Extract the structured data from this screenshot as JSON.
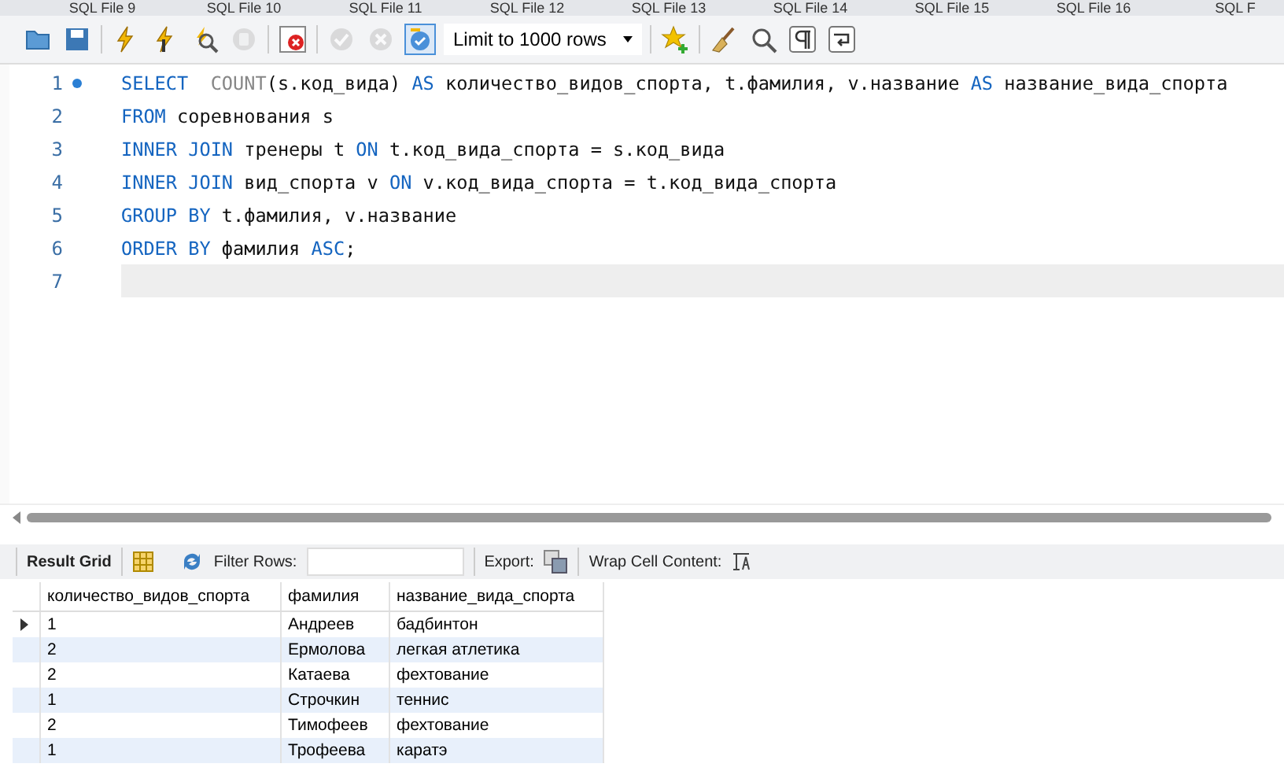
{
  "file_tabs": [
    {
      "label": "SQL File 9"
    },
    {
      "label": "SQL File 10"
    },
    {
      "label": "SQL File 11"
    },
    {
      "label": "SQL File 12"
    },
    {
      "label": "SQL File 13"
    },
    {
      "label": "SQL File 14"
    },
    {
      "label": "SQL File 15"
    },
    {
      "label": "SQL File 16"
    },
    {
      "label": "SQL F"
    }
  ],
  "toolbar": {
    "buttons": [
      {
        "kind": "folder",
        "disabled": false
      },
      {
        "kind": "save",
        "disabled": false
      },
      {
        "kind": "sep"
      },
      {
        "kind": "bolt",
        "disabled": false
      },
      {
        "kind": "bolt-cursor",
        "disabled": false
      },
      {
        "kind": "explain",
        "disabled": false
      },
      {
        "kind": "stop",
        "disabled": true
      },
      {
        "kind": "sep"
      },
      {
        "kind": "stop-on-error",
        "disabled": false
      },
      {
        "kind": "sep"
      },
      {
        "kind": "commit",
        "disabled": true
      },
      {
        "kind": "rollback",
        "disabled": true
      },
      {
        "kind": "autocommit",
        "disabled": false,
        "selected": true
      },
      {
        "kind": "limit",
        "value": "Limit to 1000 rows"
      },
      {
        "kind": "sep"
      },
      {
        "kind": "star",
        "disabled": false
      },
      {
        "kind": "sep"
      },
      {
        "kind": "broom",
        "disabled": false
      },
      {
        "kind": "find",
        "disabled": false
      },
      {
        "kind": "pilcrow",
        "disabled": false
      },
      {
        "kind": "wrap",
        "disabled": false
      }
    ]
  },
  "editor": {
    "lines": [
      {
        "number": "1",
        "marked": true,
        "current": false,
        "tokens": [
          {
            "kind": "keyword",
            "text": "SELECT  "
          },
          {
            "kind": "function",
            "text": "COUNT"
          },
          {
            "kind": "text",
            "text": "(s.код_вида) "
          },
          {
            "kind": "keyword",
            "text": "AS"
          },
          {
            "kind": "text",
            "text": " количество_видов_спорта, t.фамилия, v.название "
          },
          {
            "kind": "keyword",
            "text": "AS"
          },
          {
            "kind": "text",
            "text": " название_вида_спорта"
          }
        ]
      },
      {
        "number": "2",
        "marked": false,
        "current": false,
        "tokens": [
          {
            "kind": "keyword",
            "text": "FROM"
          },
          {
            "kind": "text",
            "text": " соревнования s"
          }
        ]
      },
      {
        "number": "3",
        "marked": false,
        "current": false,
        "tokens": [
          {
            "kind": "keyword",
            "text": "INNER JOIN"
          },
          {
            "kind": "text",
            "text": " тренеры t "
          },
          {
            "kind": "keyword",
            "text": "ON"
          },
          {
            "kind": "text",
            "text": " t.код_вида_спорта = s.код_вида"
          }
        ]
      },
      {
        "number": "4",
        "marked": false,
        "current": false,
        "tokens": [
          {
            "kind": "keyword",
            "text": "INNER JOIN"
          },
          {
            "kind": "text",
            "text": " вид_спорта v "
          },
          {
            "kind": "keyword",
            "text": "ON"
          },
          {
            "kind": "text",
            "text": " v.код_вида_спорта = t.код_вида_спорта"
          }
        ]
      },
      {
        "number": "5",
        "marked": false,
        "current": false,
        "tokens": [
          {
            "kind": "keyword",
            "text": "GROUP BY"
          },
          {
            "kind": "text",
            "text": " t.фамилия, v.название"
          }
        ]
      },
      {
        "number": "6",
        "marked": false,
        "current": false,
        "tokens": [
          {
            "kind": "keyword",
            "text": "ORDER BY"
          },
          {
            "kind": "text",
            "text": " фамилия "
          },
          {
            "kind": "keyword",
            "text": "ASC"
          },
          {
            "kind": "text",
            "text": ";"
          }
        ]
      },
      {
        "number": "7",
        "marked": false,
        "current": true
      }
    ]
  },
  "result_toolbar": {
    "tab": "Result Grid",
    "filter_label": "Filter Rows:",
    "export_label": "Export:",
    "wrap_label": "Wrap Cell Content:"
  },
  "grid": {
    "columns": [
      "количество_видов_спорта",
      "фамилия",
      "название_вида_спорта"
    ],
    "rows": [
      {
        "selected": true,
        "cells": [
          "1",
          "Андреев",
          "бадбинтон"
        ]
      },
      {
        "selected": false,
        "cells": [
          "2",
          "Ермолова",
          "легкая атлетика"
        ]
      },
      {
        "selected": false,
        "cells": [
          "2",
          "Катаева",
          "фехтование"
        ]
      },
      {
        "selected": false,
        "cells": [
          "1",
          "Строчкин",
          "теннис"
        ]
      },
      {
        "selected": false,
        "cells": [
          "2",
          "Тимофеев",
          "фехтование"
        ]
      },
      {
        "selected": false,
        "cells": [
          "1",
          "Трофеева",
          "каратэ"
        ]
      }
    ]
  }
}
